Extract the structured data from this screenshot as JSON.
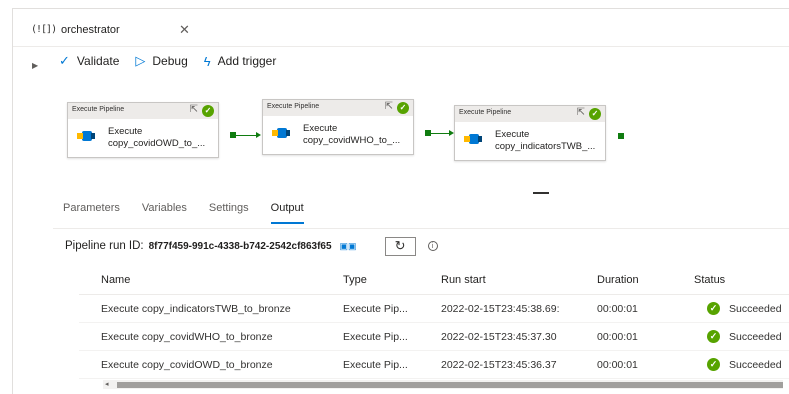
{
  "tab": {
    "icon": "pipeline-icon",
    "title": "orchestrator",
    "close": "✕"
  },
  "toolbar": {
    "validate": "Validate",
    "debug": "Debug",
    "add_trigger": "Add trigger"
  },
  "canvas": {
    "nodes": [
      {
        "type": "Execute Pipeline",
        "label1": "Execute",
        "label2": "copy_covidOWD_to_..."
      },
      {
        "type": "Execute Pipeline",
        "label1": "Execute",
        "label2": "copy_covidWHO_to_..."
      },
      {
        "type": "Execute Pipeline",
        "label1": "Execute",
        "label2": "copy_indicatorsTWB_..."
      }
    ]
  },
  "panel_tabs": [
    "Parameters",
    "Variables",
    "Settings",
    "Output"
  ],
  "active_tab": "Output",
  "run": {
    "label": "Pipeline run ID:",
    "id": "8f77f459-991c-4338-b742-2542cf863f65"
  },
  "table": {
    "headers": [
      "Name",
      "Type",
      "Run start",
      "Duration",
      "Status"
    ],
    "rows": [
      {
        "name": "Execute copy_indicatorsTWB_to_bronze",
        "type": "Execute Pip...",
        "run_start": "2022-02-15T23:45:38.69:",
        "duration": "00:00:01",
        "status": "Succeeded"
      },
      {
        "name": "Execute copy_covidWHO_to_bronze",
        "type": "Execute Pip...",
        "run_start": "2022-02-15T23:45:37.30",
        "duration": "00:00:01",
        "status": "Succeeded"
      },
      {
        "name": "Execute copy_covidOWD_to_bronze",
        "type": "Execute Pip...",
        "run_start": "2022-02-15T23:45:36.37",
        "duration": "00:00:01",
        "status": "Succeeded"
      }
    ]
  },
  "colors": {
    "accent": "#0078d4",
    "success": "#57a300",
    "edge": "#107c10"
  }
}
